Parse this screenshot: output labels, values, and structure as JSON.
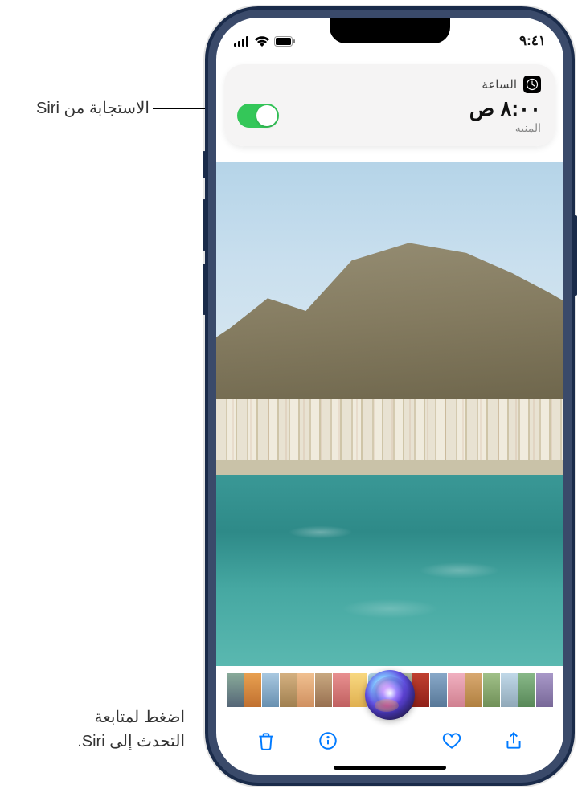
{
  "status_bar": {
    "time": "٩:٤١"
  },
  "siri_card": {
    "app_name": "الساعة",
    "time": "٨:٠٠ ص",
    "label": "المنبه",
    "toggle_on": true
  },
  "callouts": {
    "response": "الاستجابة من Siri",
    "continue": "اضغط لمتابعة التحدث إلى Siri."
  },
  "colors": {
    "ios_blue": "#007aff",
    "toggle_green": "#34c759"
  }
}
